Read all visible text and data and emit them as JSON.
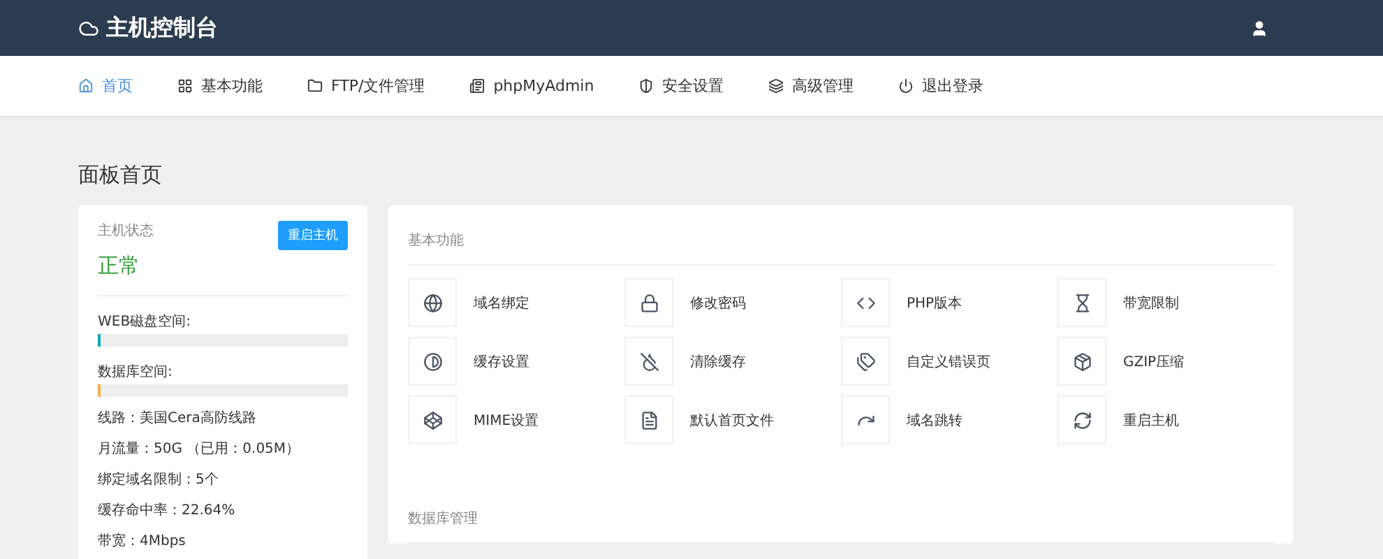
{
  "header": {
    "title": "主机控制台"
  },
  "nav": [
    {
      "label": "首页",
      "selected": true
    },
    {
      "label": "基本功能",
      "selected": false
    },
    {
      "label": "FTP/文件管理",
      "selected": false
    },
    {
      "label": "phpMyAdmin",
      "selected": false
    },
    {
      "label": "安全设置",
      "selected": false
    },
    {
      "label": "高级管理",
      "selected": false
    },
    {
      "label": "退出登录",
      "selected": false
    }
  ],
  "page_title": "面板首页",
  "status_card": {
    "label": "主机状态",
    "status": "正常",
    "button": "重启主机",
    "meters": [
      {
        "label": "WEB磁盘空间:",
        "level": 0.01,
        "color": "#17a2b8"
      },
      {
        "label": "数据库空间:",
        "level": 0.01,
        "color": "#f0ad4e"
      }
    ],
    "info": [
      "线路：美国Cera高防线路",
      "月流量：50G （已用：0.05M）",
      "绑定域名限制：5个",
      "缓存命中率：22.64%",
      "带宽：4Mbps"
    ]
  },
  "sections": [
    {
      "title": "基本功能",
      "items": [
        "域名绑定",
        "修改密码",
        "PHP版本",
        "带宽限制",
        "缓存设置",
        "清除缓存",
        "自定义错误页",
        "GZIP压缩",
        "MIME设置",
        "默认首页文件",
        "域名跳转",
        "重启主机"
      ]
    },
    {
      "title": "数据库管理"
    }
  ]
}
